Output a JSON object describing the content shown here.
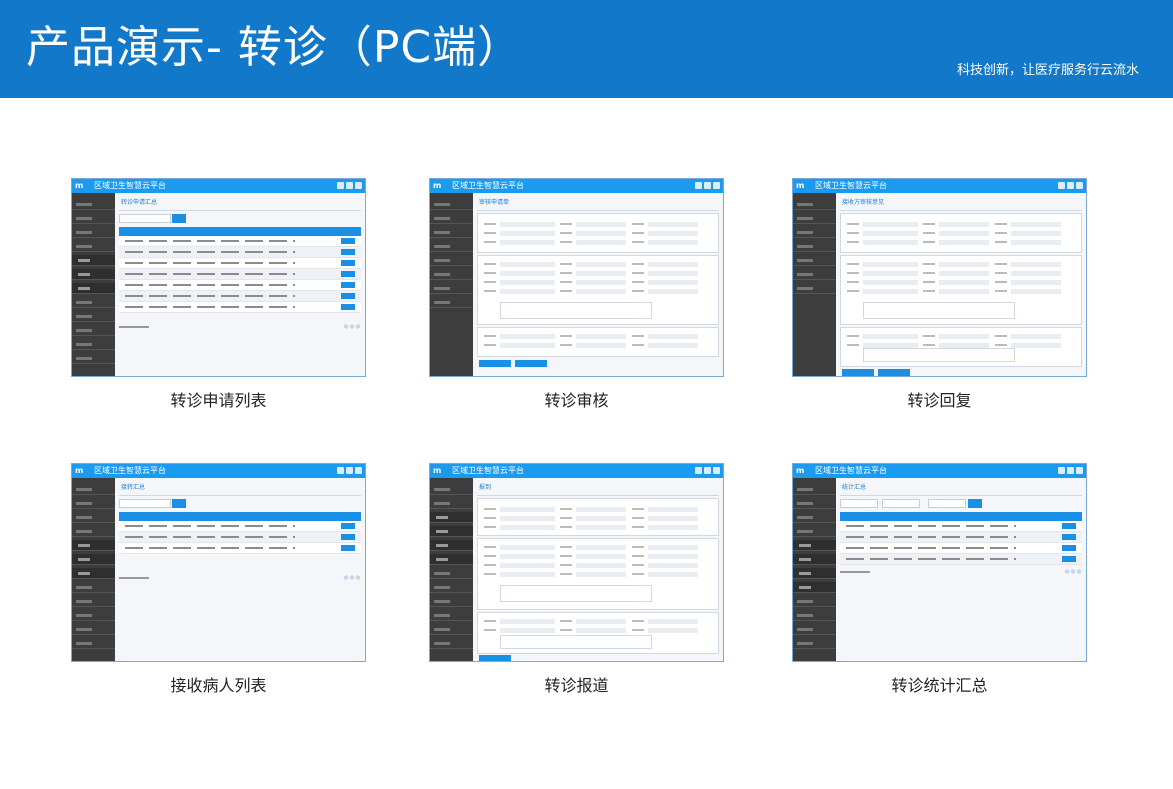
{
  "header": {
    "title": "产品演示- 转诊（PC端）",
    "slogan": "科技创新，让医疗服务行云流水",
    "background_color": "#1278c9"
  },
  "app_mock": {
    "brand": "区域卫生智慧云平台",
    "top_bar_color": "#1a9bf0",
    "sidebar_color": "#3d3d3d"
  },
  "screens": [
    {
      "caption": "转诊申请列表",
      "heading": "转诊申请汇总"
    },
    {
      "caption": "转诊审核",
      "heading": "审核申请单"
    },
    {
      "caption": "转诊回复",
      "heading": "接收方审核意见"
    },
    {
      "caption": "接收病人列表",
      "heading": "接转汇总"
    },
    {
      "caption": "转诊报道",
      "heading": "报到"
    },
    {
      "caption": "转诊统计汇总",
      "heading": "统计汇总"
    }
  ]
}
